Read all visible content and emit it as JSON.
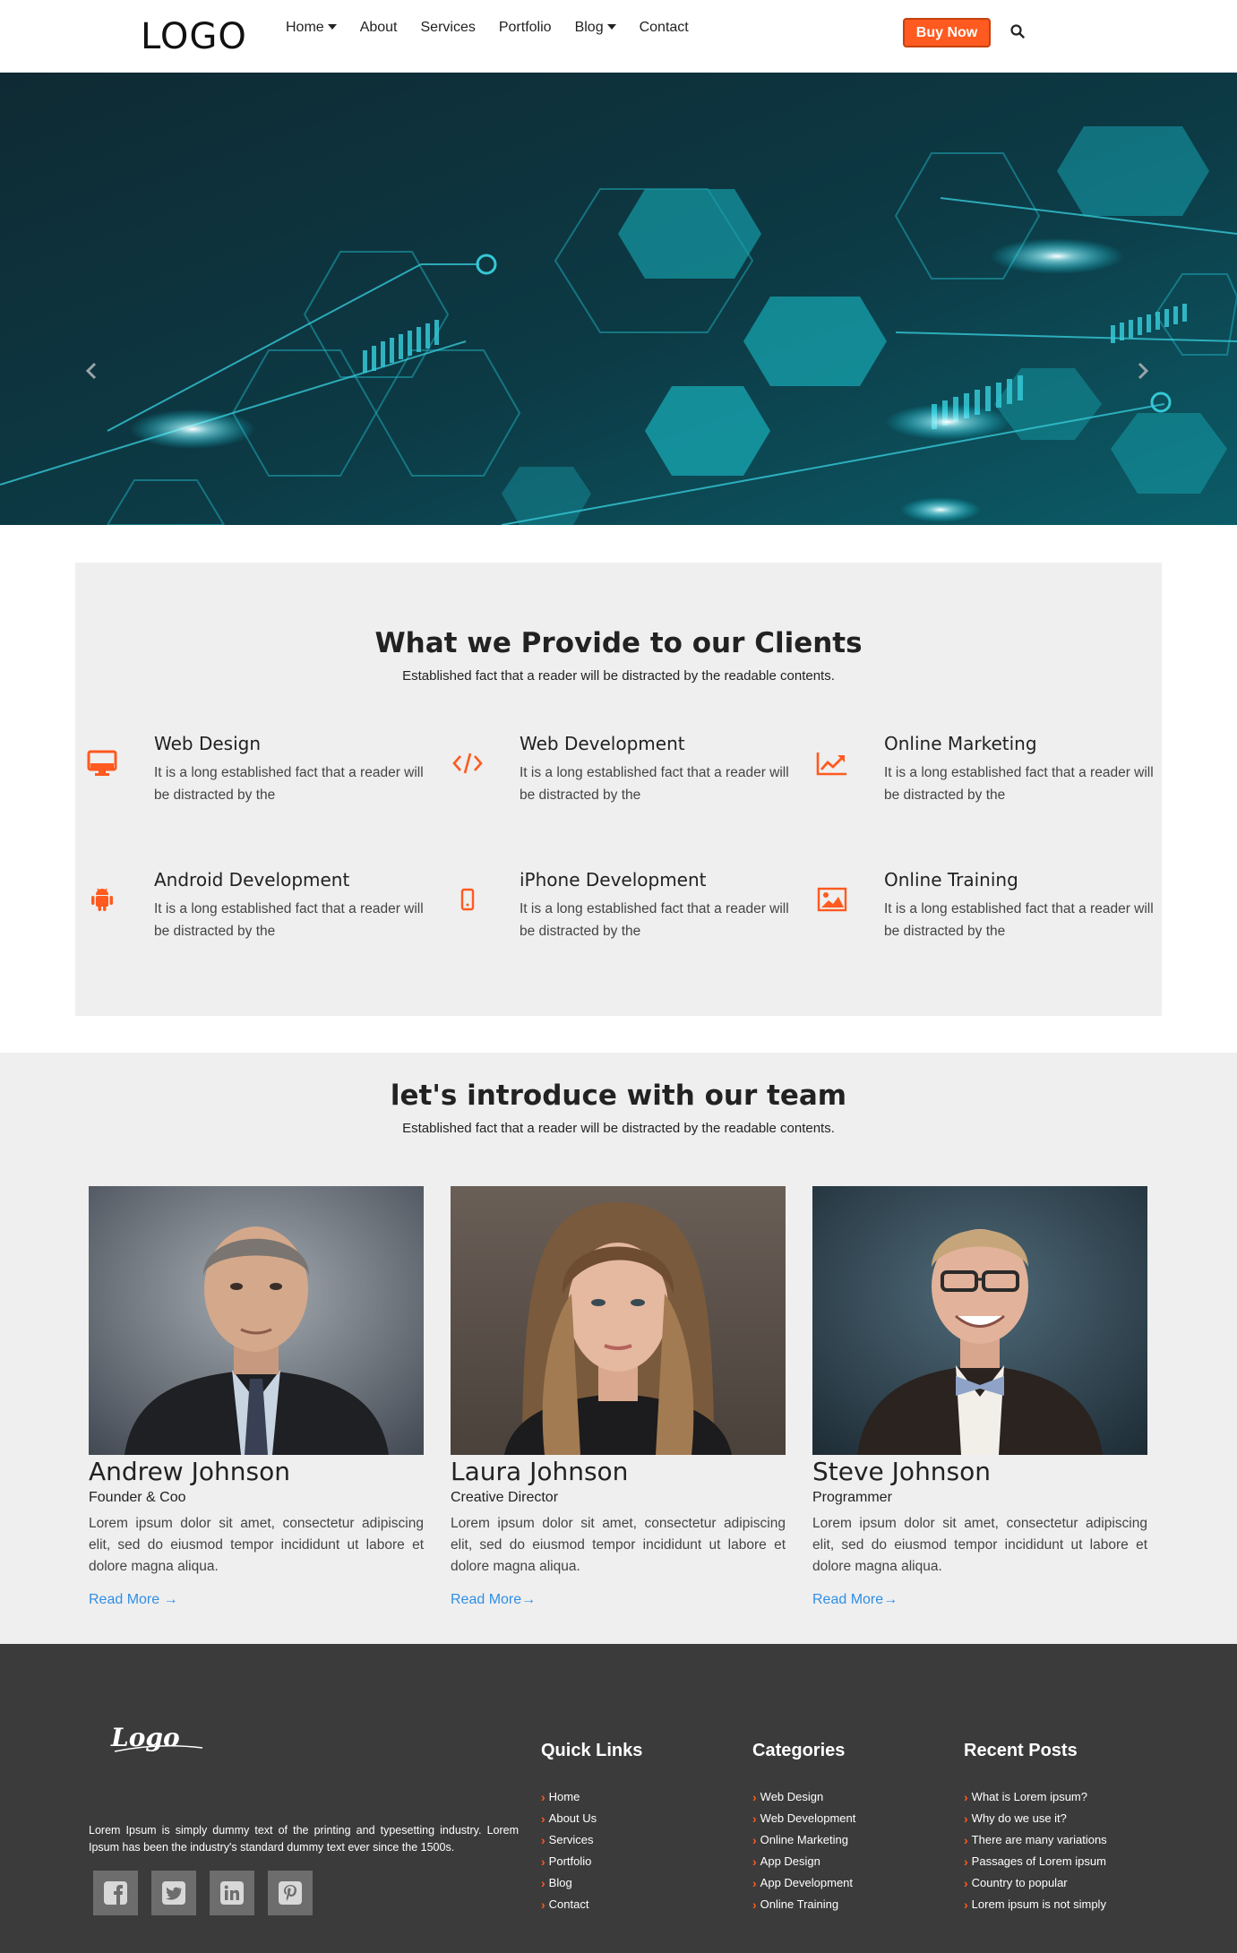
{
  "colors": {
    "accent": "#ff5a1f",
    "link": "#2f8fe6",
    "footer_bg": "#3b3b3b",
    "section_bg": "#efefef"
  },
  "nav": {
    "logo": "LOGO",
    "items": [
      {
        "label": "Home",
        "dropdown": true
      },
      {
        "label": "About",
        "dropdown": false
      },
      {
        "label": "Services",
        "dropdown": false
      },
      {
        "label": "Portfolio",
        "dropdown": false
      },
      {
        "label": "Blog",
        "dropdown": true
      },
      {
        "label": "Contact",
        "dropdown": false
      }
    ],
    "buy_label": "Buy Now",
    "search_icon": "search-icon"
  },
  "hero": {
    "prev_icon": "chevron-left-icon",
    "next_icon": "chevron-right-icon"
  },
  "services": {
    "title": "What we Provide to our Clients",
    "subtitle": "Established fact that a reader will be distracted by the readable contents.",
    "items": [
      {
        "title": "Web Design",
        "text": "It is a long established fact that a reader will be distracted by the",
        "icon": "desktop-icon"
      },
      {
        "title": "Web Development",
        "text": "It is a long established fact that a reader will be distracted by the",
        "icon": "code-icon"
      },
      {
        "title": "Online Marketing",
        "text": "It is a long established fact that a reader will be distracted by the",
        "icon": "chart-line-icon"
      },
      {
        "title": "Android Development",
        "text": "It is a long established fact that a reader will be distracted by the",
        "icon": "android-icon"
      },
      {
        "title": "iPhone Development",
        "text": "It is a long established fact that a reader will be distracted by the",
        "icon": "mobile-icon"
      },
      {
        "title": "Online Training",
        "text": "It is a long established fact that a reader will be distracted by the",
        "icon": "image-icon"
      }
    ]
  },
  "team": {
    "title": "let's introduce with our team",
    "subtitle": "Established fact that a reader will be distracted by the readable contents.",
    "members": [
      {
        "name": "Andrew Johnson",
        "role": "Founder & Coo",
        "bio": "Lorem ipsum dolor sit amet, consectetur adipiscing elit, sed do eiusmod tempor incididunt ut labore et dolore magna aliqua.",
        "read_more": "Read More →"
      },
      {
        "name": "Laura Johnson",
        "role": "Creative Director",
        "bio": "Lorem ipsum dolor sit amet, consectetur adipiscing elit, sed do eiusmod tempor incididunt ut labore et dolore magna aliqua.",
        "read_more": "Read More→"
      },
      {
        "name": "Steve Johnson",
        "role": "Programmer",
        "bio": "Lorem ipsum dolor sit amet, consectetur adipiscing elit, sed do eiusmod tempor incididunt ut labore et dolore magna aliqua.",
        "read_more": "Read More→"
      }
    ]
  },
  "footer": {
    "logo_text": "Logo",
    "about": "Lorem Ipsum is simply dummy text of the printing and typesetting industry. Lorem Ipsum has been the industry's standard dummy text ever since the 1500s.",
    "social": [
      "facebook-icon",
      "twitter-icon",
      "linkedin-icon",
      "pinterest-icon"
    ],
    "quick_links": {
      "title": "Quick Links",
      "items": [
        "Home",
        "About Us",
        "Services",
        "Portfolio",
        "Blog",
        "Contact"
      ]
    },
    "categories": {
      "title": "Categories",
      "items": [
        "Web Design",
        "Web Development",
        "Online Marketing",
        "App Design",
        "App Development",
        "Online Training"
      ]
    },
    "recent_posts": {
      "title": "Recent Posts",
      "items": [
        "What is Lorem ipsum?",
        "Why do we use it?",
        "There are many variations",
        "Passages of Lorem ipsum",
        "Country to popular",
        "Lorem ipsum is not simply"
      ]
    }
  }
}
